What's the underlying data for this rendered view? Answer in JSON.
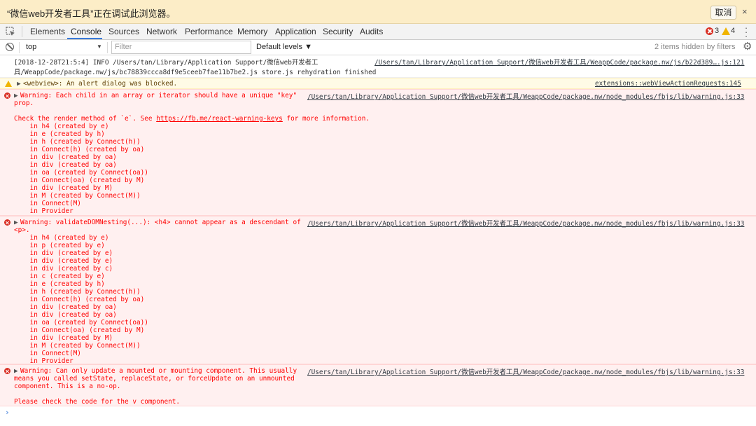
{
  "banner": {
    "message": "“微信web开发者工具”正在调试此浏览器。",
    "cancel_label": "取消",
    "close_glyph": "×"
  },
  "tabs": [
    {
      "label": "Elements",
      "active": false
    },
    {
      "label": "Console",
      "active": true
    },
    {
      "label": "Sources",
      "active": false
    },
    {
      "label": "Network",
      "active": false
    },
    {
      "label": "Performance",
      "active": false
    },
    {
      "label": "Memory",
      "active": false
    },
    {
      "label": "Application",
      "active": false
    },
    {
      "label": "Security",
      "active": false
    },
    {
      "label": "Audits",
      "active": false
    }
  ],
  "counts": {
    "errors": "3",
    "warnings": "4"
  },
  "filterbar": {
    "context": "top",
    "filter_placeholder": "Filter",
    "levels": "Default levels ▼",
    "hidden": "2 items hidden by filters"
  },
  "colors": {
    "accent": "#3879d9",
    "error": "#d93025",
    "warning": "#f0b400",
    "banner": "#fcedc7"
  },
  "messages": {
    "info": {
      "lines": [
        "[2018-12-28T21:5:4] INFO /Users/tan/Library/Application Support/微信web开发者工",
        "具/WeappCode/package.nw/js/bc78839ccca8df9e5ceeb7fae11b7be2.js store.js rehydration finished"
      ],
      "source": "/Users/tan/Library/Application Support/微信web开发者工具/WeappCode/package.nw/js/b22d389….js:121"
    },
    "warn": {
      "text": "<webview>: An alert dialog was blocked.",
      "source": "extensions::webViewActionRequests:145"
    },
    "error1": {
      "header": "Warning: Each child in an array or iterator should have a unique \"key\"",
      "header2": "prop.",
      "check_prefix": "Check the render method of `e`. See ",
      "check_link": "https://fb.me/react-warning-keys",
      "check_suffix": " for more information.",
      "stack": [
        "    in h4 (created by e)",
        "    in e (created by h)",
        "    in h (created by Connect(h))",
        "    in Connect(h) (created by oa)",
        "    in div (created by oa)",
        "    in div (created by oa)",
        "    in oa (created by Connect(oa))",
        "    in Connect(oa) (created by M)",
        "    in div (created by M)",
        "    in M (created by Connect(M))",
        "    in Connect(M)",
        "    in Provider"
      ],
      "source": "/Users/tan/Library/Application Support/微信web开发者工具/WeappCode/package.nw/node_modules/fbjs/lib/warning.js:33"
    },
    "error2": {
      "header": "Warning: validateDOMNesting(...): <h4> cannot appear as a descendant of",
      "header2": "<p>.",
      "stack": [
        "    in h4 (created by e)",
        "    in p (created by e)",
        "    in div (created by e)",
        "    in div (created by e)",
        "    in div (created by c)",
        "    in c (created by e)",
        "    in e (created by h)",
        "    in h (created by Connect(h))",
        "    in Connect(h) (created by oa)",
        "    in div (created by oa)",
        "    in div (created by oa)",
        "    in oa (created by Connect(oa))",
        "    in Connect(oa) (created by M)",
        "    in div (created by M)",
        "    in M (created by Connect(M))",
        "    in Connect(M)",
        "    in Provider"
      ],
      "source": "/Users/tan/Library/Application Support/微信web开发者工具/WeappCode/package.nw/node_modules/fbjs/lib/warning.js:33"
    },
    "error3": {
      "lines": [
        "Warning: Can only update a mounted or mounting component. This usually",
        "means you called setState, replaceState, or forceUpdate on an unmounted",
        "component. This is a no-op."
      ],
      "footer": "Please check the code for the v component.",
      "source": "/Users/tan/Library/Application Support/微信web开发者工具/WeappCode/package.nw/node_modules/fbjs/lib/warning.js:33"
    }
  },
  "prompt_glyph": "›"
}
